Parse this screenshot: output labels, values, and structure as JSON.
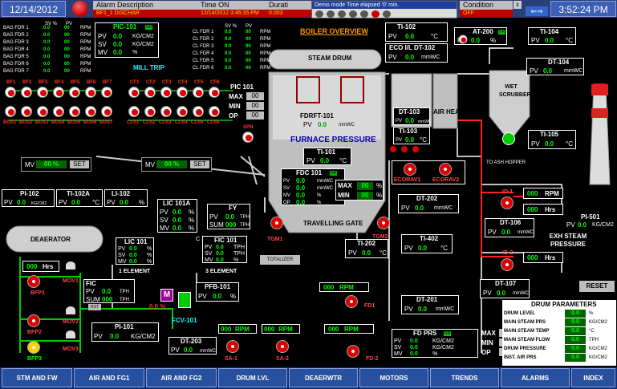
{
  "header": {
    "date": "12/14/2012",
    "time": "3:52:24 PM",
    "alarm_cols": [
      "Alarm Description",
      "Time ON",
      "Durati",
      "Condition"
    ],
    "alarm_row": [
      "BF1_1 DISCHAR",
      "12/14/2012 3:46:35 PM",
      "0.003",
      "OFF"
    ],
    "demo_text": "Demo mode Time elapsed '0' min.",
    "close": "x",
    "arrows": "⇐⇒"
  },
  "units": {
    "rpm": "RPM",
    "kgcm2": "KG/CM2",
    "pct": "%",
    "hrs": "Hrs",
    "tph": "TPH",
    "mmwc": "mmWC",
    "degc": "°C",
    "sv": "SV %",
    "pv": "PV"
  },
  "bag_table": {
    "rows": [
      "BAG FDR 1",
      "BAG FDR 2",
      "BAG FDR 3",
      "BAG FDR 4",
      "BAG FDR 5",
      "BAG FDR 6",
      "BAG FDR 7"
    ],
    "sv": "0.0",
    "pv": "00"
  },
  "pic101": {
    "title": "PIC-101",
    "pv": "0.0",
    "sv": "0.0",
    "mv": "0.0",
    "badge": "NR",
    "unit_pv": "KG/CM2",
    "unit_sv": "KG/CM2",
    "unit_mv": "%",
    "trip": "MILL TRIP"
  },
  "cl_table": {
    "rows": [
      "CL FDR 1",
      "CL FDR 2",
      "CL FDR 3",
      "CL FDR 4",
      "CL FDR 5",
      "CL FDR 6"
    ],
    "sv": "0.0",
    "pv": "00"
  },
  "boiler": {
    "title": "BOILER OVERVIEW",
    "steam_drum": "STEAM DRUM",
    "furnace": "FURNACE PRESSURE",
    "travelling": "TRAVELLING GATE",
    "totalizer": "TOTALIZER",
    "air_heater": "AIR HEATER",
    "wet_scrubber": "WET SCRUBBER",
    "ash": "TO ASH HOPPER",
    "exh": "EXH STEAM PRESSURE",
    "deaerator": "DEAERATOR",
    "spn": "SPN"
  },
  "bf_labels": [
    "BF1",
    "BF2",
    "BF3",
    "BF4",
    "BF5",
    "BF6",
    "BF7"
  ],
  "bgs_labels": [
    "BGS1",
    "BGS2",
    "BGS3",
    "BGS4",
    "BGS5",
    "BGS6",
    "BGS7"
  ],
  "cf_labels": [
    "CF1",
    "CF2",
    "CF3",
    "CF4",
    "CF5",
    "CF6"
  ],
  "cls_labels": [
    "CLS1",
    "CLS2",
    "CLS3",
    "CLS4",
    "CLS5",
    "CLS6"
  ],
  "mv_left": {
    "label": "MV",
    "value": "00 %",
    "btn": "SET"
  },
  "mv_right": {
    "label": "MV",
    "value": "00 %",
    "btn": "SET"
  },
  "pic101b": {
    "title": "PIC 101",
    "max": "MAX",
    "min": "MIN",
    "op": "OP",
    "v": "00"
  },
  "fdrft": {
    "title": "FDRFT-101",
    "pv": "0.0",
    "unit": "mmWC"
  },
  "ti101": {
    "title": "TI-101",
    "pv": "0.0",
    "unit": "°C"
  },
  "fdc101": {
    "title": "FDC 101",
    "badge": "NR",
    "pv": "0.0",
    "sv": "0.0",
    "mv": "0.0",
    "op": "0.0",
    "max": "MAX",
    "min": "MIN",
    "maxv": "00",
    "minv": "00"
  },
  "ti102": {
    "title": "TI-102",
    "pv": "0.0"
  },
  "eco": {
    "title": "ECO I/L DT-102",
    "pv": "0.0"
  },
  "dt103": {
    "title": "DT-103",
    "pv": "0.0"
  },
  "ti103": {
    "title": "TI-103",
    "pv": "0.0"
  },
  "at200": {
    "title": "AT-200",
    "pv": "0.0",
    "badge": "NR"
  },
  "ti104": {
    "title": "TI-104",
    "pv": "0.0"
  },
  "dt104": {
    "title": "DT-104",
    "pv": "0.0"
  },
  "ti105": {
    "title": "TI-105",
    "pv": "0.0"
  },
  "ecorav1": "ECORAV1",
  "ecorav2": "ECORAV2",
  "dt202": {
    "title": "DT-202",
    "pv": "0.0"
  },
  "ti402": {
    "title": "TI-402",
    "pv": "0.0"
  },
  "ti202": {
    "title": "TI-202",
    "pv": "0.0"
  },
  "id1": {
    "title": "ID-1",
    "rpm": "000",
    "hrs": "000"
  },
  "dt106": {
    "title": "DT-106",
    "pv": "0.0"
  },
  "id2": {
    "title": "ID-2",
    "hrs": "000"
  },
  "dt107": {
    "title": "DT-107",
    "pv": "0.0"
  },
  "pi501": {
    "title": "PI-501",
    "pv": "0.0"
  },
  "reset": "RESET",
  "pi102": {
    "title": "PI-102",
    "pv": "0.0"
  },
  "ti102a": {
    "title": "TI-102A",
    "pv": "0.0"
  },
  "li102": {
    "title": "LI-102",
    "pv": "0.0"
  },
  "lic101a": {
    "title": "LIC 101A",
    "pv": "0.0",
    "sv": "0.0",
    "mv": "0.0"
  },
  "fy": {
    "title": "FY",
    "pv": "0.0",
    "sum": "000",
    "sum_label": "SUM"
  },
  "lic101": {
    "title": "LIC 101",
    "pv": "0.0",
    "sv": "0.0",
    "mv": "0.0",
    "note": "1 ELEMENT"
  },
  "fic101": {
    "title": "FIC 101",
    "pv": "0.0",
    "sv": "0.0",
    "mv": "0.0",
    "note": "3 ELEMENT"
  },
  "tgm1": "TGM1",
  "tgm2": "TGM2",
  "bfp": {
    "hrs": "000",
    "bfp1": "BFP1",
    "bfp2": "BFP2",
    "bfp3": "BFP3",
    "mov1": "MOV1",
    "mov2": "MOV2",
    "mov3": "MOV3"
  },
  "fic": {
    "title": "FIC",
    "pv": "0.0",
    "sum": "000",
    "sum_label": "SUM",
    "rst": "RST"
  },
  "fcv101": {
    "label": "FCV-101",
    "pct": "0.0 %",
    "m": "M"
  },
  "pfb101": {
    "title": "PFB-101",
    "pv": "0.0"
  },
  "pi101": {
    "title": "PI-101",
    "pv": "0.0"
  },
  "fd1": {
    "title": "FD1",
    "rpm": "000",
    "unit": "RPM"
  },
  "dt201": {
    "title": "DT-201",
    "pv": "0.0"
  },
  "dt203": {
    "title": "DT-203",
    "pv": "0.0"
  },
  "sa1": {
    "title": "SA-1",
    "rpm": "000"
  },
  "sa2": {
    "title": "SA-2",
    "rpm": "000"
  },
  "fdprs": {
    "title": "FD PRS",
    "badge": "NR",
    "pv": "0.0",
    "sv": "0.0",
    "mv": "0.0",
    "max": "MAX",
    "min": "MIN",
    "op": "OP",
    "v": "00",
    "fd2": "FD-2"
  },
  "drum_params": {
    "title": "DRUM PARAMETERS",
    "rows": [
      {
        "name": "DRUM LEVEL",
        "value": "0.0",
        "unit": "%"
      },
      {
        "name": "MAIN STEAM PRS",
        "value": "0.0",
        "unit": "KG/CM2"
      },
      {
        "name": "MAIN STEAM TEMP",
        "value": "0.0",
        "unit": "°C"
      },
      {
        "name": "MAIN STEAM FLOW",
        "value": "0.0",
        "unit": "TPH"
      },
      {
        "name": "DRUM PRESSURE",
        "value": "0.0",
        "unit": "KG/CM2"
      },
      {
        "name": "INST. AIR PRS",
        "value": "0.0",
        "unit": "KG/CM2"
      }
    ]
  },
  "nav": [
    "STM AND FW",
    "AIR AND FG1",
    "AIR AND FG2",
    "DRUM LVL",
    "DEAERWTR",
    "MOTORS",
    "TRENDS",
    "ALARMS",
    "INDEX"
  ]
}
